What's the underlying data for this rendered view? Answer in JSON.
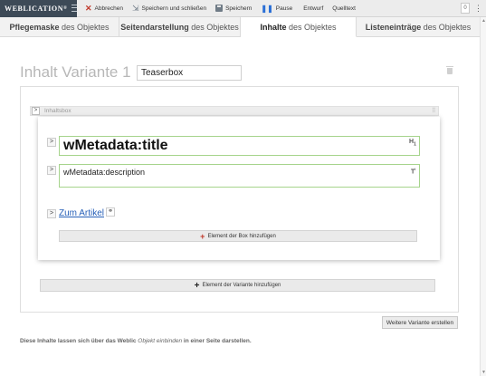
{
  "toolbar": {
    "brand": "Weblication",
    "brand_mark": "®",
    "buttons": [
      {
        "label": "Abbrechen",
        "icon": "cancel-icon"
      },
      {
        "label": "Speichern und schließen",
        "icon": "save-close-icon"
      },
      {
        "label": "Speichern",
        "icon": "save-icon"
      },
      {
        "label": "Pause",
        "icon": "pause-icon"
      },
      {
        "label": "Entwurf"
      },
      {
        "label": "Quelltext"
      }
    ],
    "counter": "0",
    "more": "⋮"
  },
  "tabs": [
    {
      "bold": "Pflegemaske",
      "rest": " des Objektes"
    },
    {
      "bold": "Seitendarstellung",
      "rest": " des Objektes"
    },
    {
      "bold": "Inhalte",
      "rest": " des Objektes",
      "active": true
    },
    {
      "bold": "Listeneinträge",
      "rest": " des Objektes"
    }
  ],
  "content": {
    "heading": "Inhalt Variante 1",
    "variant_name": "Teaserbox",
    "box_label": "Inhaltsbox",
    "title_field": "wMetadata:title",
    "description_field": "wMetadata:description",
    "link_text": "Zum Artikel",
    "add_box_element": "Element der Box hinzufügen",
    "add_variant_element": "Element der Variante hinzufügen",
    "new_variant": "Weitere Variante erstellen",
    "footnote_start": "Diese Inhalte lassen sich über das Weblic ",
    "footnote_italic": "Objekt einbinden",
    "footnote_end": " in einer Seite darstellen."
  },
  "colors": {
    "brand_bg": "#3d4a57",
    "field_border": "#a6d48c",
    "link": "#2760b8",
    "cancel": "#c0392b",
    "pause": "#2a6fd6"
  }
}
